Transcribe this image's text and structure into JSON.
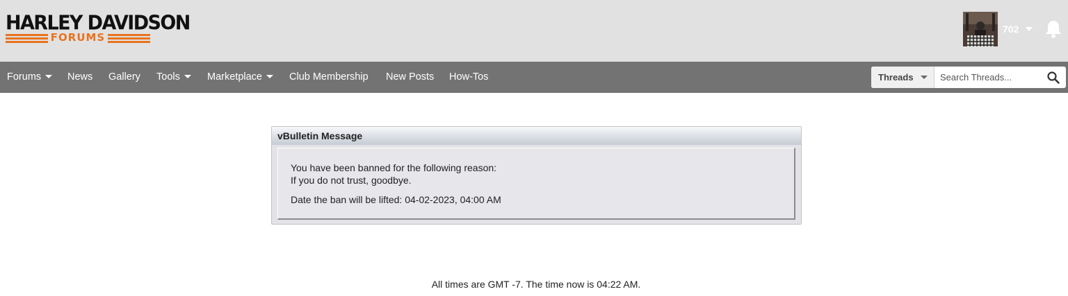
{
  "logo": {
    "top_text": "HARLEY DAVIDSON",
    "bottom_text": "FORUMS",
    "accent": "#e8731e"
  },
  "user": {
    "count": "702",
    "avatar_icon": "avatar",
    "notifications_icon": "bell-icon"
  },
  "nav": {
    "items": [
      {
        "label": "Forums",
        "dropdown": true
      },
      {
        "label": "News",
        "dropdown": false
      },
      {
        "label": "Gallery",
        "dropdown": false
      },
      {
        "label": "Tools",
        "dropdown": true
      },
      {
        "label": "Marketplace",
        "dropdown": true
      },
      {
        "label": "Club Membership",
        "dropdown": false
      },
      {
        "label": "New Posts",
        "dropdown": false
      },
      {
        "label": "How-Tos",
        "dropdown": false
      }
    ],
    "background": "#737373"
  },
  "search": {
    "scope": "Threads",
    "placeholder": "Search Threads...",
    "value": "",
    "icon": "search-icon"
  },
  "message": {
    "title": "vBulletin Message",
    "line1": "You have been banned for the following reason:",
    "line2": "If you do not trust, goodbye.",
    "line3": "Date the ban will be lifted: 04-02-2023, 04:00 AM"
  },
  "footer": {
    "time_text": "All times are GMT -7. The time now is 04:22 AM."
  }
}
